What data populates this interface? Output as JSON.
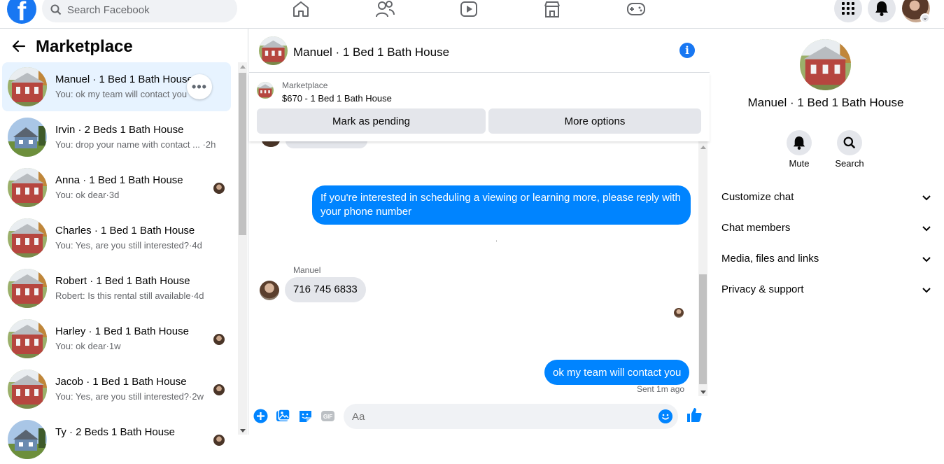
{
  "topbar": {
    "logo": "f",
    "search_placeholder": "Search Facebook",
    "nav_icons": [
      "home-icon",
      "friends-icon",
      "watch-icon",
      "marketplace-icon",
      "gaming-icon"
    ],
    "right_icons": [
      "menu-grid-icon",
      "notifications-icon",
      "account-avatar"
    ],
    "notification_badge_color": "#e41e3f"
  },
  "sidebar": {
    "title": "Marketplace",
    "conversations": [
      {
        "name": "Manuel · 1 Bed 1 Bath House",
        "preview": "You: ok my team will contact you",
        "time": "",
        "active": true
      },
      {
        "name": "Irvin · 2 Beds 1 Bath House",
        "preview": "You: drop your name with contact ... ·2h",
        "time": "2h",
        "active": false
      },
      {
        "name": "Anna · 1 Bed 1 Bath House",
        "preview": "You: ok dear·3d",
        "time": "3d",
        "active": false
      },
      {
        "name": "Charles · 1 Bed 1 Bath House",
        "preview": "You: Yes, are you still interested?·4d",
        "time": "4d",
        "active": false
      },
      {
        "name": "Robert · 1 Bed 1 Bath House",
        "preview": "Robert: Is this rental still available·4d",
        "time": "4d",
        "active": false
      },
      {
        "name": "Harley · 1 Bed 1 Bath House",
        "preview": "You: ok dear·1w",
        "time": "1w",
        "active": false
      },
      {
        "name": "Jacob · 1 Bed 1 Bath House",
        "preview": "You: Yes, are you still interested?·2w",
        "time": "2w",
        "active": false
      },
      {
        "name": "Ty · 2 Beds 1 Bath House",
        "preview": "",
        "time": "",
        "active": false
      }
    ],
    "more_options": "•••"
  },
  "chat": {
    "title": "Manuel · 1 Bed 1 Bath House",
    "banner_label": "Marketplace",
    "banner_listing": "$670 - 1 Bed 1 Bath House",
    "mark_pending": "Mark as pending",
    "more_options": "More options",
    "msg_out_1": "If you're interested in scheduling a viewing or learning more, please reply with your phone number",
    "sender": "Manuel",
    "msg_in_1": "716 745 6833",
    "msg_out_2": "ok my team will contact you",
    "status": "Sent 1m ago",
    "composer_placeholder": "Aa"
  },
  "info_panel": {
    "name": "Manuel · 1 Bed 1 Bath House",
    "mute_label": "Mute",
    "search_label": "Search",
    "sections": [
      "Customize chat",
      "Chat members",
      "Media, files and links",
      "Privacy & support"
    ]
  },
  "colors": {
    "brand": "#1877f2",
    "bubble_out": "#0084ff",
    "bubble_in": "#e4e6eb",
    "active_row": "#e7f3ff"
  }
}
